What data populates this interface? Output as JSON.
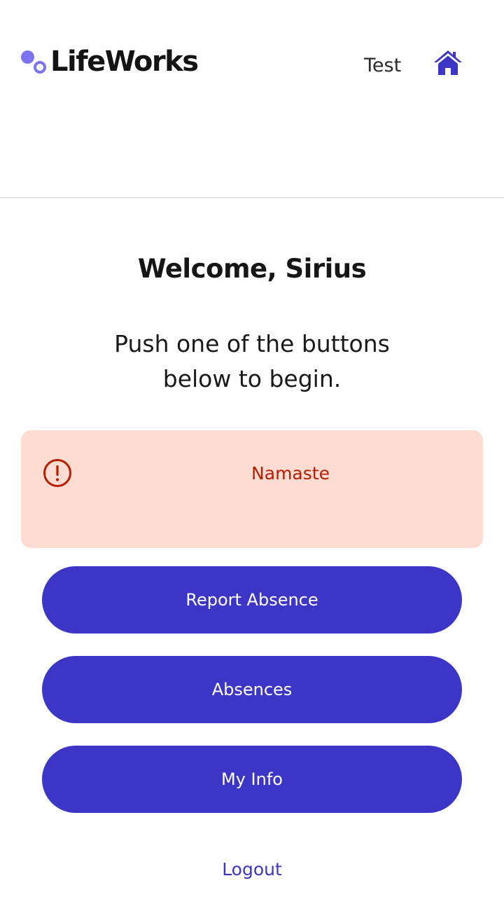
{
  "header": {
    "logo_text": "LifeWorks",
    "user_name": "Test",
    "home_icon": "home-icon"
  },
  "main": {
    "welcome": "Welcome, Sirius",
    "instructions": "Push one of the buttons below to begin."
  },
  "alert": {
    "icon": "exclamation-circle-icon",
    "message": "Namaste"
  },
  "actions": {
    "report_absence": "Report Absence",
    "absences": "Absences",
    "my_info": "My Info",
    "logout": "Logout"
  },
  "colors": {
    "brand": "#3c35c5",
    "logo_accent": "#7b73f0",
    "alert_bg": "#ffdcd2",
    "alert_text": "#b81d00"
  }
}
